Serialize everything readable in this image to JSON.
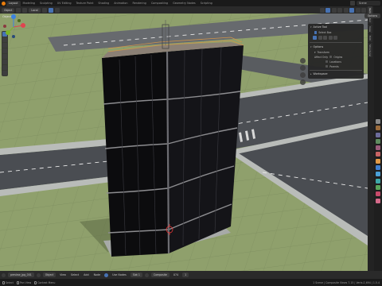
{
  "topbar": {
    "tabs": [
      "Layout",
      "Modeling",
      "Sculpting",
      "UV Editing",
      "Texture Paint",
      "Shading",
      "Animation",
      "Rendering",
      "Compositing",
      "Geometry Nodes",
      "Scripting"
    ],
    "active_tab": "Layout",
    "scene": "Scene"
  },
  "header": {
    "mode": "Object",
    "transform_orientation": "Local",
    "options_label": "Options"
  },
  "viewport": {
    "mode_text": "Object"
  },
  "tool_panel": {
    "title": "Active Tool",
    "tool_name": "Select Box",
    "options_title": "Options",
    "transform_title": "Transform",
    "affect_only_label": "Affect Only",
    "affect_origins": "Origins",
    "affect_locations": "Locations",
    "affect_parents": "Parents",
    "workspace_title": "Workspace"
  },
  "npanel_tabs": [
    "Item",
    "Tool",
    "View",
    "Edit",
    "Structural"
  ],
  "bottom_header": {
    "editor_label": "preview_jpg_001",
    "menus": [
      "View",
      "Select",
      "Add",
      "Node"
    ],
    "use_nodes_label": "Use Nodes",
    "slot_label": "Slot 1",
    "view_layer": "Composite",
    "count_label": "074",
    "frame_label": "1"
  },
  "status_bar": {
    "items": [
      "Select",
      "Pan View",
      "Context Menu"
    ],
    "stats": "1 Scene | Composite Views 7.15 | Verts:2,694 | 1.5.4"
  },
  "colors": {
    "accent": "#4772b3",
    "ground": "#8fa06c",
    "road": "#4a4d52",
    "tower_panel": "#0b0b0d",
    "deck_rail": "#d0944a"
  }
}
